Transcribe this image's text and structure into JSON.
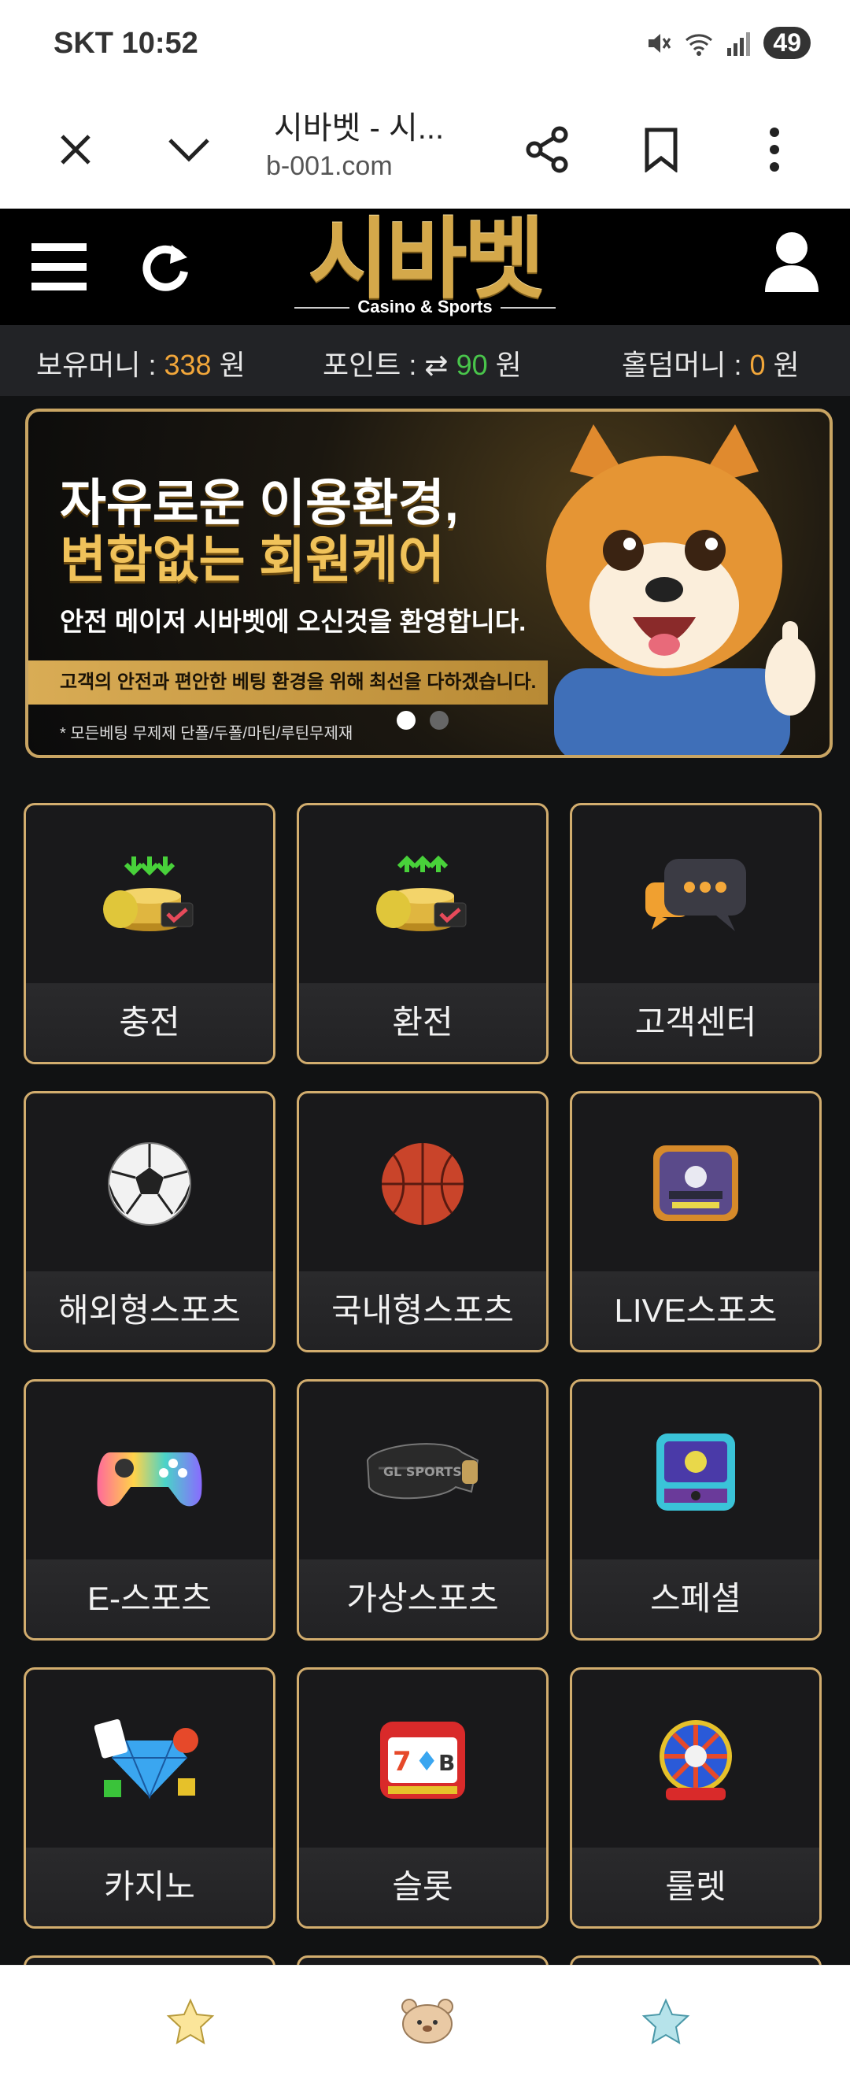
{
  "status_bar": {
    "carrier": "SKT",
    "time": "10:52",
    "battery": "49"
  },
  "browser": {
    "title": "시바벳 - 시...",
    "url": "b-001.com"
  },
  "header": {
    "logo_text": "시바벳",
    "logo_sub": "Casino & Sports"
  },
  "money_bar": {
    "holding_label": "보유머니 : ",
    "holding_value": "338",
    "holding_unit": " 원",
    "point_label": "포인트 : ",
    "point_value": "90",
    "point_unit": " 원",
    "holdem_label": "홀덤머니 : ",
    "holdem_value": "0",
    "holdem_unit": " 원"
  },
  "banner": {
    "headline_1": "자유로운 이용환경,",
    "headline_2": "변함없는 회원케어",
    "subline": "안전 메이저 시바벳에 오신것을 환영합니다.",
    "strip": "고객의 안전과 편안한 베팅 환경을 위해 최선을 다하겠습니다.",
    "note": "* 모든베팅 무제제 단폴/두폴/마틴/루틴무제재"
  },
  "tiles": [
    {
      "label": "충전",
      "icon": "deposit-coins-icon"
    },
    {
      "label": "환전",
      "icon": "withdraw-coins-icon"
    },
    {
      "label": "고객센터",
      "icon": "chat-bubble-icon"
    },
    {
      "label": "해외형스포츠",
      "icon": "soccer-ball-icon"
    },
    {
      "label": "국내형스포츠",
      "icon": "basketball-icon"
    },
    {
      "label": "LIVE스포츠",
      "icon": "live-tv-icon"
    },
    {
      "label": "E-스포츠",
      "icon": "gamepad-icon"
    },
    {
      "label": "가상스포츠",
      "icon": "vr-headset-icon"
    },
    {
      "label": "스페셜",
      "icon": "arcade-icon"
    },
    {
      "label": "카지노",
      "icon": "casino-diamond-icon"
    },
    {
      "label": "슬롯",
      "icon": "slot-machine-icon"
    },
    {
      "label": "룰렛",
      "icon": "roulette-wheel-icon"
    }
  ],
  "colors": {
    "accent_gold": "#d2ad6e",
    "money_orange": "#f1a63a",
    "point_green": "#49c54b",
    "background": "#111213"
  }
}
